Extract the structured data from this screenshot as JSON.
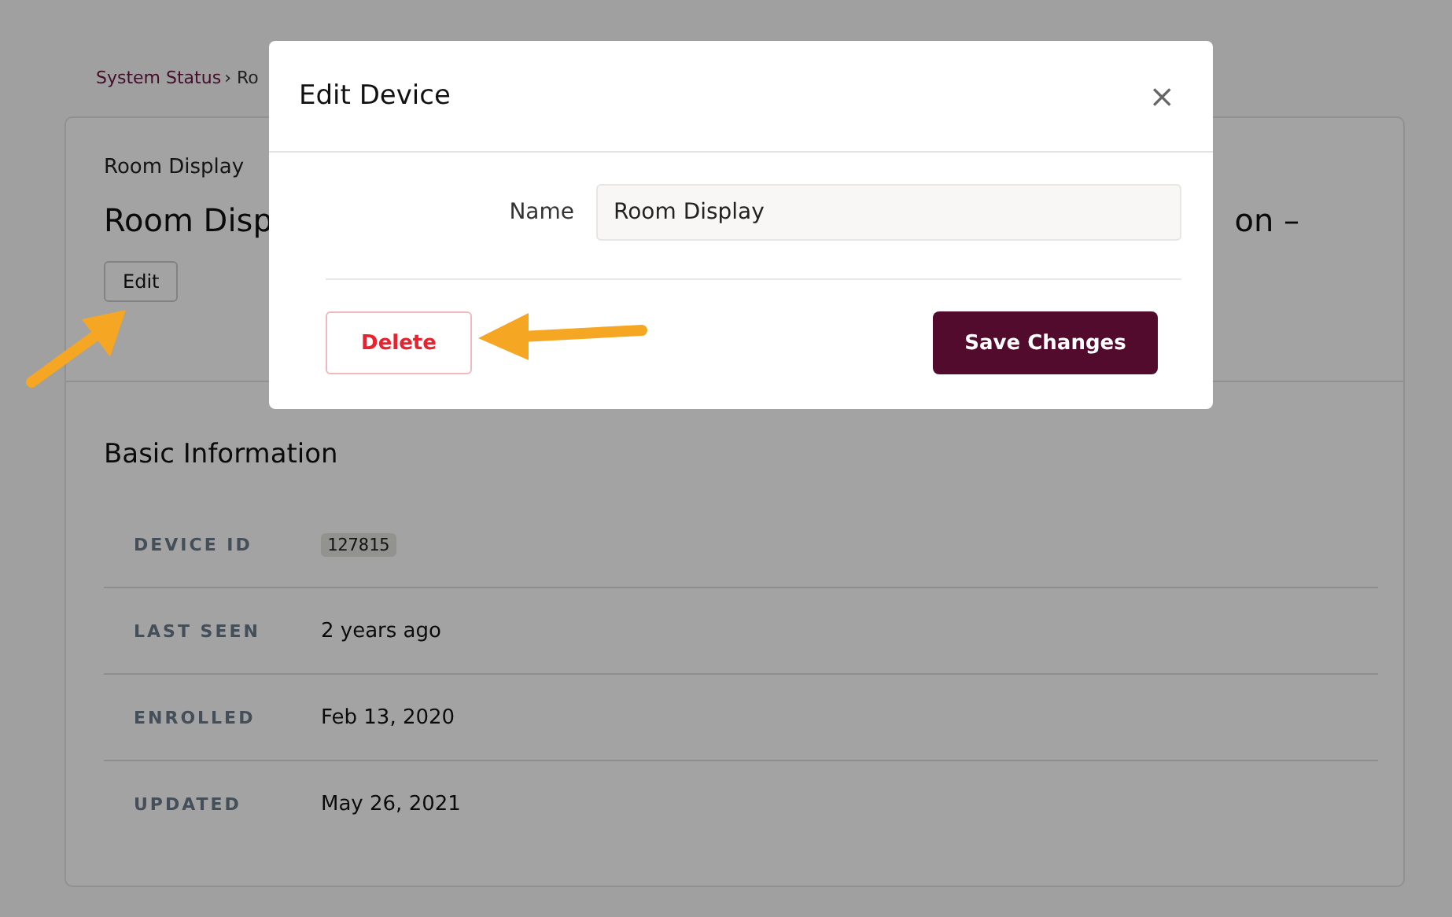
{
  "breadcrumb": {
    "link": "System Status",
    "rest": "› Ro"
  },
  "device_header": {
    "subtitle": "Room Display",
    "title_left": "Room Disp",
    "title_right": "on –",
    "edit_button": "Edit"
  },
  "basic_information": {
    "title": "Basic Information",
    "rows": [
      {
        "label": "DEVICE ID",
        "value": "127815",
        "kind": "code"
      },
      {
        "label": "LAST SEEN",
        "value": "2 years ago",
        "kind": "text"
      },
      {
        "label": "ENROLLED",
        "value": "Feb 13, 2020",
        "kind": "text"
      },
      {
        "label": "UPDATED",
        "value": "May 26, 2021",
        "kind": "text"
      }
    ]
  },
  "modal": {
    "title": "Edit Device",
    "close": "×",
    "field_label": "Name",
    "field_value": "Room Display",
    "delete_button": "Delete",
    "save_button": "Save Changes"
  }
}
